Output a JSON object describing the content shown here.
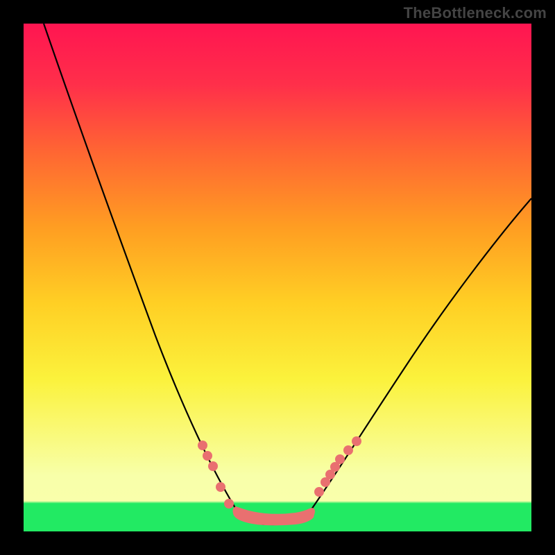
{
  "watermark": "TheBottleneck.com",
  "chart_data": {
    "type": "line",
    "title": "",
    "xlabel": "",
    "ylabel": "",
    "xlim": [
      0,
      100
    ],
    "ylim": [
      0,
      100
    ],
    "grid": false,
    "legend": false,
    "series": [
      {
        "name": "bottleneck-curve",
        "x": [
          4,
          6,
          10,
          15,
          20,
          25,
          30,
          34,
          37,
          39,
          41,
          43,
          45,
          47,
          50,
          53,
          56,
          59,
          62,
          66,
          71,
          77,
          84,
          92,
          100
        ],
        "y": [
          100,
          92,
          79,
          65,
          52,
          39,
          27,
          18,
          12,
          8,
          5,
          3,
          2,
          2,
          2,
          3,
          5,
          8,
          12,
          17,
          24,
          31,
          39,
          47,
          55
        ]
      }
    ],
    "markers_left": {
      "name": "points-left-branch",
      "x": [
        35.5,
        36.5,
        37.5,
        39.0,
        41.0
      ],
      "y": [
        16.5,
        14.5,
        12.5,
        8.5,
        5.0
      ]
    },
    "markers_right": {
      "name": "points-right-branch",
      "x": [
        58.0,
        59.5,
        60.5,
        61.5,
        62.5,
        64.0,
        65.5
      ],
      "y": [
        7.5,
        9.5,
        11.0,
        12.5,
        14.0,
        16.0,
        17.5
      ]
    },
    "bottom_region": {
      "name": "optimal-zone",
      "x_range": [
        42,
        55
      ],
      "y": 2.2
    },
    "colors": {
      "curve": "#000000",
      "markers": "#e97070",
      "gradient_top": "#ff1551",
      "gradient_mid": "#fbf23c",
      "gradient_bottom_band": "#22ea63",
      "frame": "#000000"
    }
  }
}
